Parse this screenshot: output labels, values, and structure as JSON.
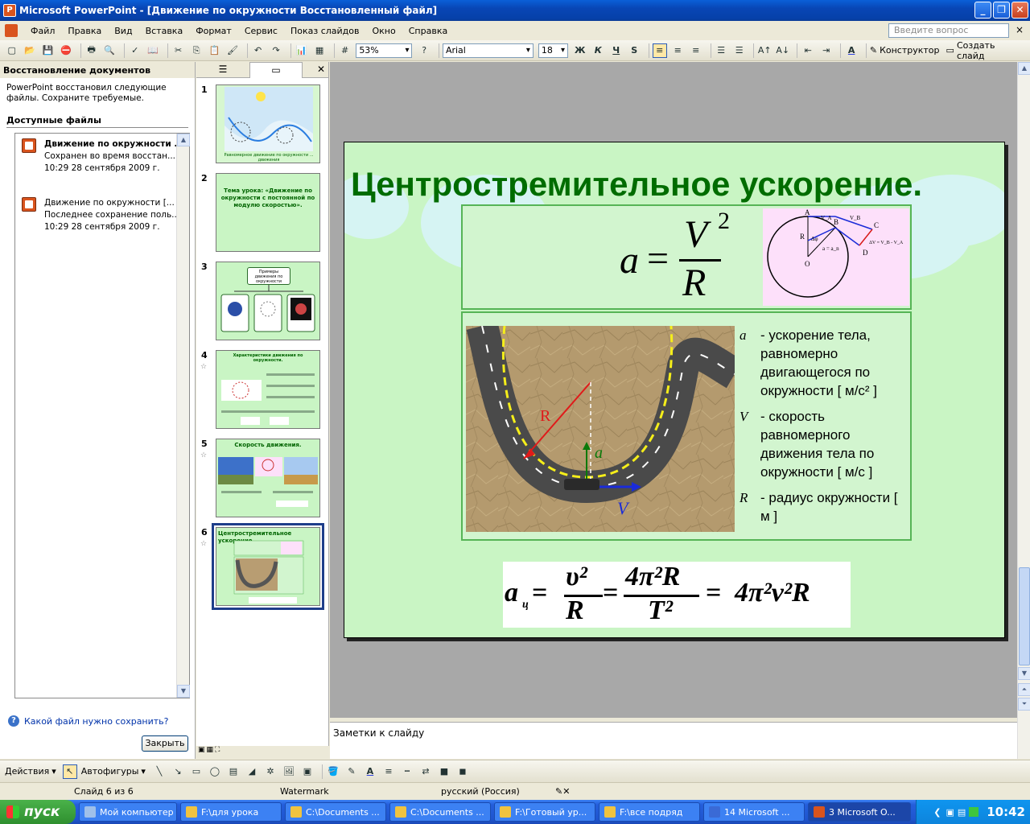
{
  "window": {
    "title": "Microsoft PowerPoint - [Движение по окружности Восстановленный файл]",
    "controls": [
      "_",
      "❐",
      "✕"
    ]
  },
  "menu": {
    "items": [
      "Файл",
      "Правка",
      "Вид",
      "Вставка",
      "Формат",
      "Сервис",
      "Показ слайдов",
      "Окно",
      "Справка"
    ],
    "help_placeholder": "Введите вопрос",
    "close": "×"
  },
  "toolbar": {
    "zoom": "53%",
    "font": "Arial",
    "font_size": "18",
    "bold": "Ж",
    "italic": "К",
    "underline": "Ч",
    "shadow": "S",
    "designer": "Конструктор",
    "new_slide": "Создать слайд"
  },
  "taskpane": {
    "title": "Восстановление документов",
    "message": "PowerPoint восстановил следующие файлы. Сохраните требуемые.",
    "available_header": "Доступные файлы",
    "files": [
      {
        "name": "Движение по окружности ...",
        "status": "Сохранен во время восстан...",
        "time": "10:29 28 сентября 2009 г."
      },
      {
        "name": "Движение по окружности  [...",
        "status": "Последнее сохранение поль...",
        "time": "10:29 28 сентября 2009 г."
      }
    ],
    "help_link": "Какой файл нужно сохранить?",
    "close_button": "Закрыть"
  },
  "slides_pane": {
    "tab_outline_icon": "outline-icon",
    "tab_slides_icon": "slides-icon",
    "thumbnails": [
      {
        "num": "1",
        "caption": "Равномерное движение по окружности ... движения"
      },
      {
        "num": "2",
        "caption": "Тема урока: «Движение по окружности с постоянной по модулю скоростью»."
      },
      {
        "num": "3",
        "caption": "Примеры движения по окружности"
      },
      {
        "num": "4",
        "caption": "Характеристики движения по окружности."
      },
      {
        "num": "5",
        "caption": "Скорость движения."
      },
      {
        "num": "6",
        "caption": "Центростремительное ускорение."
      }
    ]
  },
  "slide": {
    "title": "Центростремительное ускорение.",
    "formula_a": "a",
    "formula_eq": "=",
    "formula_num": "V",
    "formula_pow": "2",
    "formula_den": "R",
    "legend": [
      {
        "sym": "a",
        "text": "- ускорение тела, равномерно двигающегося по окружности [ м/с² ]"
      },
      {
        "sym": "V",
        "text": "- скорость равномерного движения тела по окружности [ м/с ]"
      },
      {
        "sym": "R",
        "text": "- радиус окружности [ м ]"
      }
    ],
    "road_labels": {
      "r": "R",
      "a_vec": "a",
      "v_vec": "V"
    },
    "circle_labels": [
      "A",
      "B",
      "C",
      "D",
      "R",
      "O",
      "Δφ",
      "V_A",
      "V_B",
      "ΔV = V_B - V_A",
      "a = a_n"
    ],
    "bottom_formula": {
      "a": "a",
      "a_sub": "ц",
      "eq1": "=",
      "frac1_num": "υ²",
      "frac1_den": "R",
      "eq2": "=",
      "frac2_num": "4π²R",
      "frac2_den": "T²",
      "eq3": "=",
      "rhs": "4π²ν²R"
    }
  },
  "notes": {
    "placeholder": "Заметки к слайду"
  },
  "drawbar": {
    "actions": "Действия",
    "autoshapes": "Автофигуры"
  },
  "status": {
    "slide": "Слайд 6 из 6",
    "template": "Watermark",
    "language": "русский (Россия)"
  },
  "taskbar": {
    "start": "пуск",
    "tasks": [
      "Мой компьютер",
      "F:\\для урока",
      "C:\\Documents ...",
      "C:\\Documents ...",
      "F:\\Готовый ур...",
      "F:\\все подряд",
      "14 Microsoft ...",
      "3 Microsoft O..."
    ],
    "clock": "10:42"
  }
}
